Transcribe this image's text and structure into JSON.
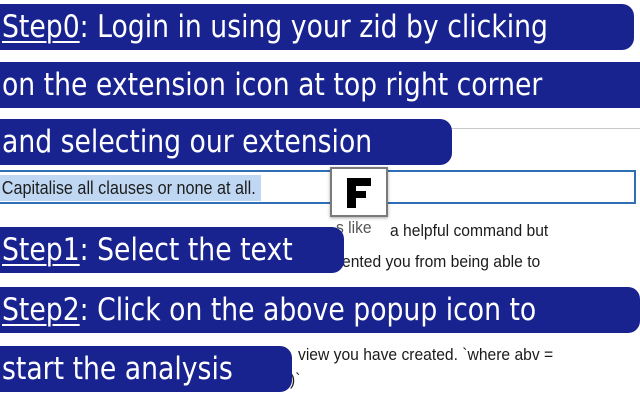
{
  "steps": {
    "step0": {
      "label": "Step0",
      "sep": ":",
      "line1": " Login in using your zid by clicking",
      "line2": "on the extension icon at top right corner",
      "line3": "and selecting our extension"
    },
    "step1": {
      "label": "Step1",
      "sep": ":",
      "text": " Select the text"
    },
    "step2": {
      "label": "Step2",
      "sep": ":",
      "line1": " Click on the above popup icon to",
      "line2": "start the analysis"
    }
  },
  "document": {
    "selected_clause": "Capitalise all clauses or none at all.",
    "fragment1": "a helpful command but",
    "fragment2": "ented you from being able to",
    "fragment3": "view you have created. `where  abv =",
    "fragment4": ")`",
    "fragment0": "s like"
  },
  "popup": {
    "icon": "extension-popup-icon"
  },
  "colors": {
    "callout": "#18238f",
    "selection": "#bfd7f2",
    "border": "#2f6fb6"
  }
}
